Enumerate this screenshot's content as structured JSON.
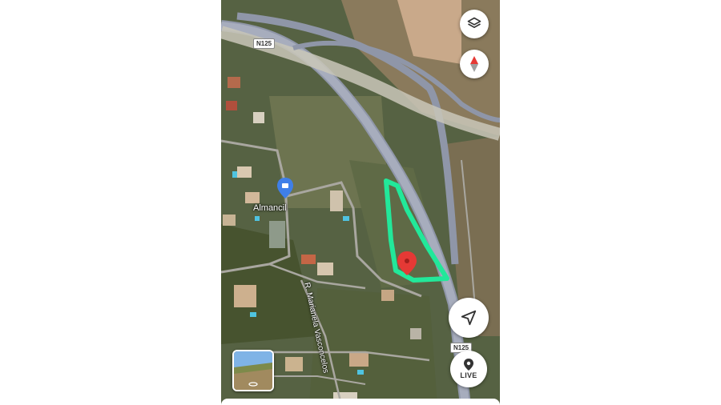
{
  "map": {
    "place_label": "Almancil",
    "street_label": "R. Marianela Vasconcelos",
    "road_shield_top": "N125",
    "road_shield_bottom": "N125"
  },
  "controls": {
    "layers_icon": "layers-icon",
    "compass_icon": "compass-icon",
    "navigate_icon": "navigation-arrow-icon",
    "live_label": "LIVE"
  },
  "colors": {
    "highlight_outline": "#22e89a",
    "pin": "#e53935",
    "highway": "#c9c7b8"
  }
}
